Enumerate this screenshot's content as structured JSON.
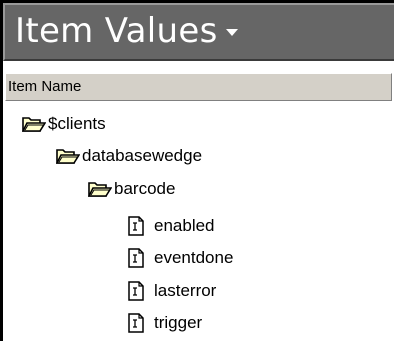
{
  "panel": {
    "title": "Item Values"
  },
  "list": {
    "column_header": "Item Name"
  },
  "tree": {
    "root": {
      "label": "$clients",
      "icon": "open-folder-icon",
      "child": {
        "label": "databasewedge",
        "icon": "open-folder-icon",
        "child": {
          "label": "barcode",
          "icon": "open-folder-icon",
          "items": [
            {
              "label": "enabled",
              "icon": "item-document-icon"
            },
            {
              "label": "eventdone",
              "icon": "item-document-icon"
            },
            {
              "label": "lasterror",
              "icon": "item-document-icon"
            },
            {
              "label": "trigger",
              "icon": "item-document-icon"
            }
          ]
        }
      }
    }
  },
  "colors": {
    "title_bar": "#666666",
    "title_text": "#ffffff",
    "folder_fill": "#ffffcc",
    "header_face": "#d4d0c8"
  }
}
